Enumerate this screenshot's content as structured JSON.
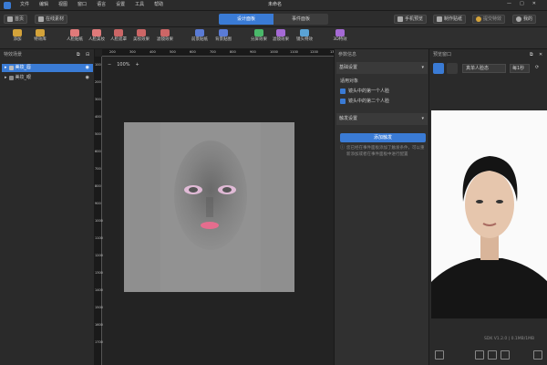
{
  "menu": [
    "文件",
    "编辑",
    "视图",
    "窗口",
    "语言",
    "设置",
    "工具",
    "帮助"
  ],
  "window_title": "未命名",
  "toolbar": {
    "home": "首页",
    "online_material": "在线素材",
    "tab_design": "设计面板",
    "tab_event": "事件面板",
    "phone_preview": "手机预览",
    "make_sticker": "制作贴纸",
    "submit_effect": "提交特效",
    "my": "我的"
  },
  "ribbon": [
    "添加",
    "特效库",
    "人脸贴纸",
    "人脸美妆",
    "人脸遮罩",
    "美妆效果",
    "滤镜效果",
    "前景贴纸",
    "背景贴图",
    "分屏效果",
    "滤镜效果",
    "镜头特效",
    "3D特效"
  ],
  "left_panel": {
    "title": "特效场景",
    "layers": [
      {
        "label": "美妆_唇",
        "selected": true
      },
      {
        "label": "美妆_眼",
        "selected": false
      }
    ]
  },
  "canvas": {
    "zoom": "100%",
    "minus": "−",
    "plus": "+",
    "ruler_top": [
      "200",
      "300",
      "400",
      "500",
      "600",
      "700",
      "800",
      "900",
      "1000",
      "1100",
      "1200",
      "13"
    ],
    "ruler_left": [
      "100",
      "200",
      "300",
      "400",
      "500",
      "600",
      "700",
      "800",
      "900",
      "1000",
      "1100",
      "1200",
      "1300",
      "1400",
      "1500",
      "1600",
      "1700"
    ]
  },
  "props": {
    "title": "参数信息",
    "section1": "基础设置",
    "apply_label": "适用对象",
    "check1": "镜头中的第一个人脸",
    "check2": "镜头中的第二个人脸",
    "section2": "触发设置",
    "add_trigger": "添加触发",
    "hint": "您已经在事件面板添加了触发条件，可以重新添加或者在事件面板中进行配置"
  },
  "preview": {
    "title": "预览窗口",
    "dropdown": "真单人脸态",
    "fps": "每1秒",
    "sdk": "SDK V1.2.0  |  0.1MB/1MB"
  },
  "colors": {
    "accent": "#3a7bd5"
  }
}
